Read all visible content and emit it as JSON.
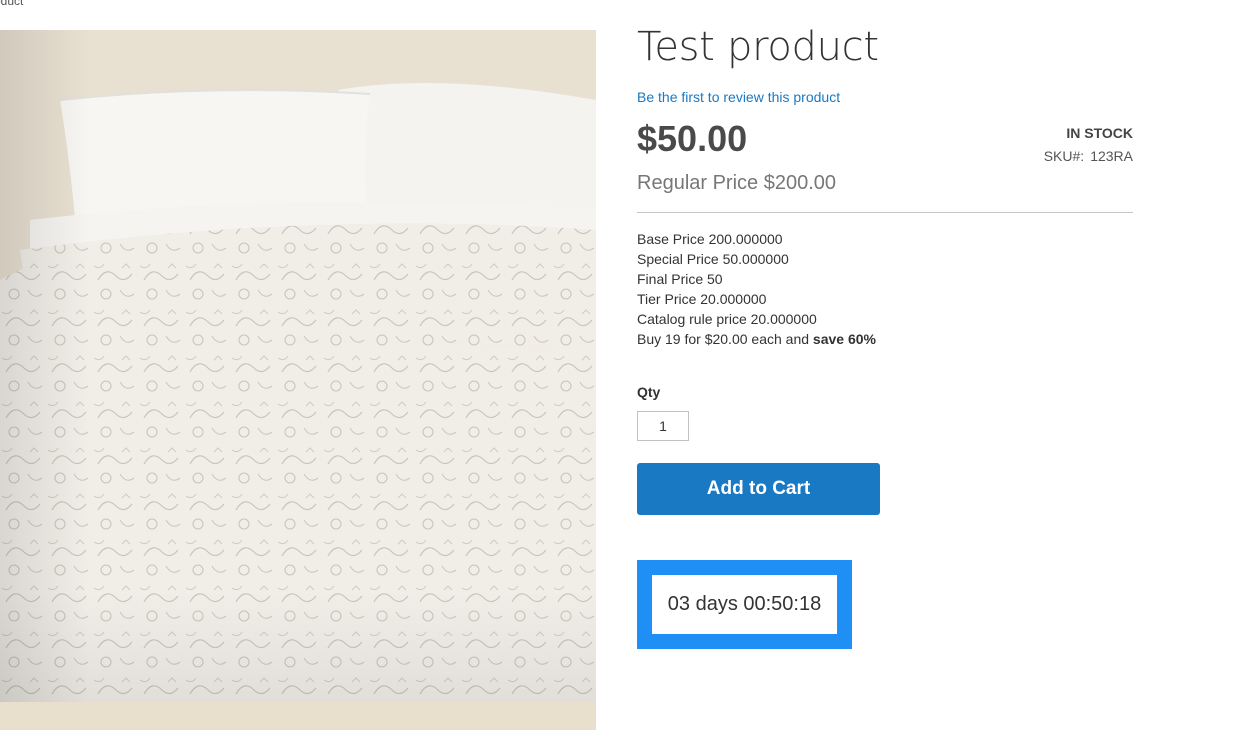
{
  "breadcrumb": {
    "current": "oduct"
  },
  "product": {
    "title": "Test product",
    "review_link": "Be the first to review this product",
    "price": "$50.00",
    "regular_price_label": "Regular Price",
    "regular_price": "$200.00",
    "stock": "IN STOCK",
    "sku_label": "SKU#:",
    "sku": "123RA"
  },
  "details": {
    "lines": [
      "Base Price 200.000000",
      "Special Price 50.000000",
      "Final Price 50",
      "Tier Price 20.000000",
      "Catalog rule price 20.000000"
    ],
    "tier_offer_prefix": "Buy 19 for $20.00 each and",
    "tier_offer_bold": "save 60%"
  },
  "cart": {
    "qty_label": "Qty",
    "qty_value": "1",
    "add_to_cart_label": "Add to Cart"
  },
  "countdown": {
    "text": "03 days 00:50:18",
    "border_color": "#1f8ef5"
  },
  "colors": {
    "link": "#1979c3",
    "button": "#1979c3"
  },
  "image": {
    "icon": "bed-quilt-product-image"
  }
}
